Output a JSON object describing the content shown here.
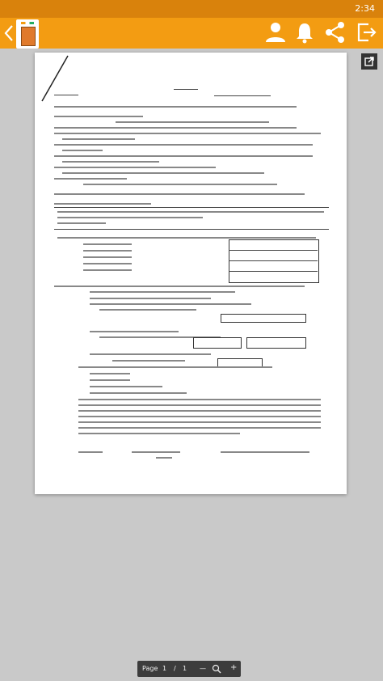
{
  "status_bar": {
    "time": "2:34"
  },
  "app_bar": {
    "logo_icon": "book-logo-icon",
    "icons": [
      "back-chevron-icon",
      "user-icon",
      "bell-icon",
      "share-icon",
      "exit-icon"
    ]
  },
  "viewer": {
    "popout_icon": "open-external-icon",
    "pager": {
      "label": "Page",
      "current_page": "1",
      "separator": "/",
      "total_pages": "1",
      "zoom_out": "—",
      "zoom_in": "+"
    }
  }
}
